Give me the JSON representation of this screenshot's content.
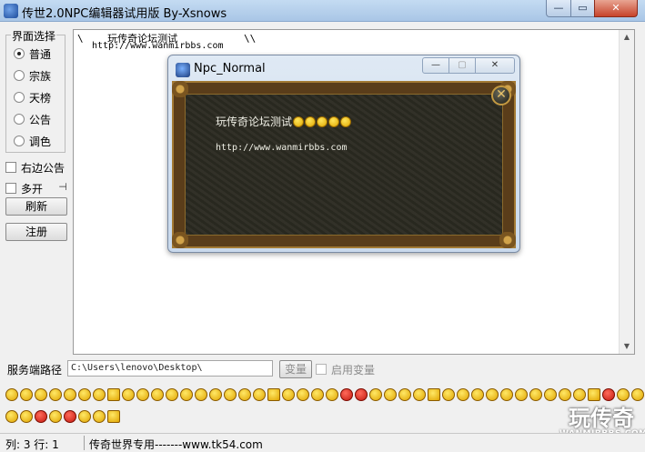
{
  "window": {
    "title": "传世2.0NPC编辑器试用版    By-Xsnows",
    "minimize_glyph": "—",
    "maximize_glyph": "▭",
    "close_glyph": "✕"
  },
  "sidebar": {
    "group_label": "界面选择",
    "options": [
      {
        "label": "普通",
        "selected": true
      },
      {
        "label": "宗族",
        "selected": false
      },
      {
        "label": "天榜",
        "selected": false
      },
      {
        "label": "公告",
        "selected": false
      },
      {
        "label": "调色",
        "selected": false
      }
    ],
    "checkbox_right_notice": "右边公告",
    "checkbox_multi_open": "多开",
    "pin_glyph": "⊣",
    "refresh_button": "刷新",
    "register_button": "注册"
  },
  "editor": {
    "line1": "\\    玩传奇论坛测试           \\\\",
    "line2": "http://www.wanmirbbs.com"
  },
  "npc_window": {
    "title": "Npc_Normal",
    "text_line1": "玩传奇论坛测试",
    "text_line2": "http://www.wanmirbbs.com",
    "close_glyph": "✕",
    "minimize_glyph": "—",
    "maximize_glyph": "▢"
  },
  "path_row": {
    "label": "服务端路径",
    "value": "C:\\Users\\lenovo\\Desktop\\",
    "change_button": "变量",
    "enable_checkbox": "启用变量"
  },
  "watermark": {
    "title": "玩传奇",
    "subtitle": "WANMIRBBS.COM"
  },
  "status": {
    "position": "列: 3 行: 1",
    "info": "传奇世界专用-------www.tk54.com"
  }
}
